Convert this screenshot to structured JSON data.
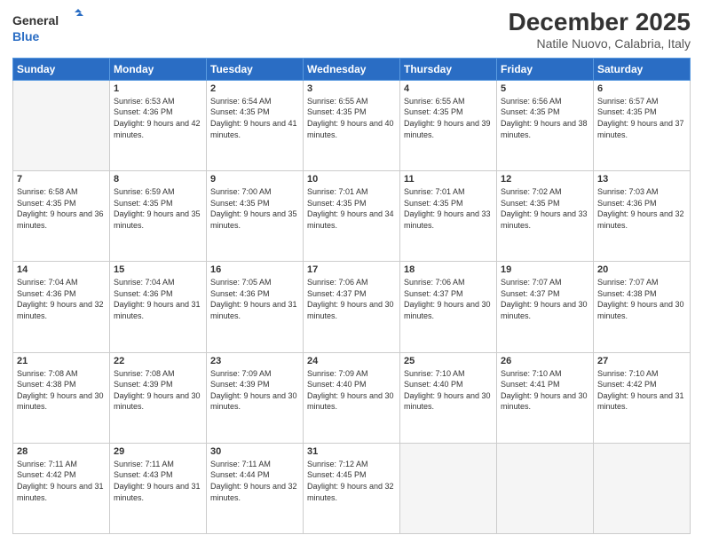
{
  "logo": {
    "line1": "General",
    "line2": "Blue"
  },
  "header": {
    "title": "December 2025",
    "subtitle": "Natile Nuovo, Calabria, Italy"
  },
  "weekdays": [
    "Sunday",
    "Monday",
    "Tuesday",
    "Wednesday",
    "Thursday",
    "Friday",
    "Saturday"
  ],
  "weeks": [
    [
      {
        "day": "",
        "empty": true
      },
      {
        "day": "1",
        "sunrise": "6:53 AM",
        "sunset": "4:36 PM",
        "daylight": "9 hours and 42 minutes."
      },
      {
        "day": "2",
        "sunrise": "6:54 AM",
        "sunset": "4:35 PM",
        "daylight": "9 hours and 41 minutes."
      },
      {
        "day": "3",
        "sunrise": "6:55 AM",
        "sunset": "4:35 PM",
        "daylight": "9 hours and 40 minutes."
      },
      {
        "day": "4",
        "sunrise": "6:55 AM",
        "sunset": "4:35 PM",
        "daylight": "9 hours and 39 minutes."
      },
      {
        "day": "5",
        "sunrise": "6:56 AM",
        "sunset": "4:35 PM",
        "daylight": "9 hours and 38 minutes."
      },
      {
        "day": "6",
        "sunrise": "6:57 AM",
        "sunset": "4:35 PM",
        "daylight": "9 hours and 37 minutes."
      }
    ],
    [
      {
        "day": "7",
        "sunrise": "6:58 AM",
        "sunset": "4:35 PM",
        "daylight": "9 hours and 36 minutes."
      },
      {
        "day": "8",
        "sunrise": "6:59 AM",
        "sunset": "4:35 PM",
        "daylight": "9 hours and 35 minutes."
      },
      {
        "day": "9",
        "sunrise": "7:00 AM",
        "sunset": "4:35 PM",
        "daylight": "9 hours and 35 minutes."
      },
      {
        "day": "10",
        "sunrise": "7:01 AM",
        "sunset": "4:35 PM",
        "daylight": "9 hours and 34 minutes."
      },
      {
        "day": "11",
        "sunrise": "7:01 AM",
        "sunset": "4:35 PM",
        "daylight": "9 hours and 33 minutes."
      },
      {
        "day": "12",
        "sunrise": "7:02 AM",
        "sunset": "4:35 PM",
        "daylight": "9 hours and 33 minutes."
      },
      {
        "day": "13",
        "sunrise": "7:03 AM",
        "sunset": "4:36 PM",
        "daylight": "9 hours and 32 minutes."
      }
    ],
    [
      {
        "day": "14",
        "sunrise": "7:04 AM",
        "sunset": "4:36 PM",
        "daylight": "9 hours and 32 minutes."
      },
      {
        "day": "15",
        "sunrise": "7:04 AM",
        "sunset": "4:36 PM",
        "daylight": "9 hours and 31 minutes."
      },
      {
        "day": "16",
        "sunrise": "7:05 AM",
        "sunset": "4:36 PM",
        "daylight": "9 hours and 31 minutes."
      },
      {
        "day": "17",
        "sunrise": "7:06 AM",
        "sunset": "4:37 PM",
        "daylight": "9 hours and 30 minutes."
      },
      {
        "day": "18",
        "sunrise": "7:06 AM",
        "sunset": "4:37 PM",
        "daylight": "9 hours and 30 minutes."
      },
      {
        "day": "19",
        "sunrise": "7:07 AM",
        "sunset": "4:37 PM",
        "daylight": "9 hours and 30 minutes."
      },
      {
        "day": "20",
        "sunrise": "7:07 AM",
        "sunset": "4:38 PM",
        "daylight": "9 hours and 30 minutes."
      }
    ],
    [
      {
        "day": "21",
        "sunrise": "7:08 AM",
        "sunset": "4:38 PM",
        "daylight": "9 hours and 30 minutes."
      },
      {
        "day": "22",
        "sunrise": "7:08 AM",
        "sunset": "4:39 PM",
        "daylight": "9 hours and 30 minutes."
      },
      {
        "day": "23",
        "sunrise": "7:09 AM",
        "sunset": "4:39 PM",
        "daylight": "9 hours and 30 minutes."
      },
      {
        "day": "24",
        "sunrise": "7:09 AM",
        "sunset": "4:40 PM",
        "daylight": "9 hours and 30 minutes."
      },
      {
        "day": "25",
        "sunrise": "7:10 AM",
        "sunset": "4:40 PM",
        "daylight": "9 hours and 30 minutes."
      },
      {
        "day": "26",
        "sunrise": "7:10 AM",
        "sunset": "4:41 PM",
        "daylight": "9 hours and 30 minutes."
      },
      {
        "day": "27",
        "sunrise": "7:10 AM",
        "sunset": "4:42 PM",
        "daylight": "9 hours and 31 minutes."
      }
    ],
    [
      {
        "day": "28",
        "sunrise": "7:11 AM",
        "sunset": "4:42 PM",
        "daylight": "9 hours and 31 minutes."
      },
      {
        "day": "29",
        "sunrise": "7:11 AM",
        "sunset": "4:43 PM",
        "daylight": "9 hours and 31 minutes."
      },
      {
        "day": "30",
        "sunrise": "7:11 AM",
        "sunset": "4:44 PM",
        "daylight": "9 hours and 32 minutes."
      },
      {
        "day": "31",
        "sunrise": "7:12 AM",
        "sunset": "4:45 PM",
        "daylight": "9 hours and 32 minutes."
      },
      {
        "day": "",
        "empty": true
      },
      {
        "day": "",
        "empty": true
      },
      {
        "day": "",
        "empty": true
      }
    ]
  ]
}
